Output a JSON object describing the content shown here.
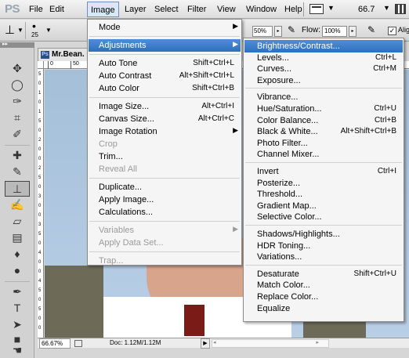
{
  "app": {
    "logo": "PS"
  },
  "menubar": {
    "items": [
      "File",
      "Edit",
      "Image",
      "Layer",
      "Select",
      "Filter",
      "View",
      "Window",
      "Help"
    ],
    "active": "Image",
    "zoom": "66.7"
  },
  "options_bar": {
    "brush_size": "25",
    "opacity": "50%",
    "flow_label": "Flow:",
    "flow": "100%",
    "aligned_label": "Aligned",
    "aligned_checked": true
  },
  "toolbox": {
    "tools": [
      "move",
      "lasso",
      "quick-selection",
      "crop",
      "eyedropper",
      "spot-healing",
      "brush",
      "clone-stamp",
      "history-brush",
      "eraser",
      "gradient",
      "blur",
      "dodge",
      "pen",
      "type",
      "path-selection",
      "rectangle",
      "hand",
      "zoom"
    ],
    "active": "clone-stamp"
  },
  "document": {
    "tab_title": "Mr.Bean.",
    "tab_icon": "Ps",
    "ruler_top": [
      "0",
      "50"
    ],
    "ruler_left": [
      "5",
      "0",
      "1",
      "0",
      "1",
      "5",
      "0",
      "2",
      "0",
      "0",
      "2",
      "5",
      "0",
      "3",
      "0",
      "0",
      "3",
      "5",
      "0",
      "4",
      "0",
      "0",
      "4",
      "5",
      "0",
      "5",
      "0",
      "0"
    ],
    "status_zoom": "66.67%",
    "status_doc": "Doc: 1.12M/1.12M"
  },
  "image_menu": {
    "items": [
      {
        "label": "Mode",
        "shortcut": "",
        "submenu": true,
        "disabled": false,
        "highlight": false
      },
      {
        "sep": true
      },
      {
        "label": "Adjustments",
        "shortcut": "",
        "submenu": true,
        "disabled": false,
        "highlight": true
      },
      {
        "sep": true
      },
      {
        "label": "Auto Tone",
        "shortcut": "Shift+Ctrl+L",
        "submenu": false,
        "disabled": false,
        "highlight": false
      },
      {
        "label": "Auto Contrast",
        "shortcut": "Alt+Shift+Ctrl+L",
        "submenu": false,
        "disabled": false,
        "highlight": false
      },
      {
        "label": "Auto Color",
        "shortcut": "Shift+Ctrl+B",
        "submenu": false,
        "disabled": false,
        "highlight": false
      },
      {
        "sep": true
      },
      {
        "label": "Image Size...",
        "shortcut": "Alt+Ctrl+I",
        "submenu": false,
        "disabled": false,
        "highlight": false
      },
      {
        "label": "Canvas Size...",
        "shortcut": "Alt+Ctrl+C",
        "submenu": false,
        "disabled": false,
        "highlight": false
      },
      {
        "label": "Image Rotation",
        "shortcut": "",
        "submenu": true,
        "disabled": false,
        "highlight": false
      },
      {
        "label": "Crop",
        "shortcut": "",
        "submenu": false,
        "disabled": true,
        "highlight": false
      },
      {
        "label": "Trim...",
        "shortcut": "",
        "submenu": false,
        "disabled": false,
        "highlight": false
      },
      {
        "label": "Reveal All",
        "shortcut": "",
        "submenu": false,
        "disabled": true,
        "highlight": false
      },
      {
        "sep": true
      },
      {
        "label": "Duplicate...",
        "shortcut": "",
        "submenu": false,
        "disabled": false,
        "highlight": false
      },
      {
        "label": "Apply Image...",
        "shortcut": "",
        "submenu": false,
        "disabled": false,
        "highlight": false
      },
      {
        "label": "Calculations...",
        "shortcut": "",
        "submenu": false,
        "disabled": false,
        "highlight": false
      },
      {
        "sep": true
      },
      {
        "label": "Variables",
        "shortcut": "",
        "submenu": true,
        "disabled": true,
        "highlight": false
      },
      {
        "label": "Apply Data Set...",
        "shortcut": "",
        "submenu": false,
        "disabled": true,
        "highlight": false
      },
      {
        "sep": true
      },
      {
        "label": "Trap...",
        "shortcut": "",
        "submenu": false,
        "disabled": true,
        "highlight": false
      }
    ]
  },
  "adjustments_menu": {
    "items": [
      {
        "label": "Brightness/Contrast...",
        "shortcut": "",
        "highlight": true
      },
      {
        "label": "Levels...",
        "shortcut": "Ctrl+L",
        "highlight": false
      },
      {
        "label": "Curves...",
        "shortcut": "Ctrl+M",
        "highlight": false
      },
      {
        "label": "Exposure...",
        "shortcut": "",
        "highlight": false
      },
      {
        "sep": true
      },
      {
        "label": "Vibrance...",
        "shortcut": "",
        "highlight": false
      },
      {
        "label": "Hue/Saturation...",
        "shortcut": "Ctrl+U",
        "highlight": false
      },
      {
        "label": "Color Balance...",
        "shortcut": "Ctrl+B",
        "highlight": false
      },
      {
        "label": "Black & White...",
        "shortcut": "Alt+Shift+Ctrl+B",
        "highlight": false
      },
      {
        "label": "Photo Filter...",
        "shortcut": "",
        "highlight": false
      },
      {
        "label": "Channel Mixer...",
        "shortcut": "",
        "highlight": false
      },
      {
        "sep": true
      },
      {
        "label": "Invert",
        "shortcut": "Ctrl+I",
        "highlight": false
      },
      {
        "label": "Posterize...",
        "shortcut": "",
        "highlight": false
      },
      {
        "label": "Threshold...",
        "shortcut": "",
        "highlight": false
      },
      {
        "label": "Gradient Map...",
        "shortcut": "",
        "highlight": false
      },
      {
        "label": "Selective Color...",
        "shortcut": "",
        "highlight": false
      },
      {
        "sep": true
      },
      {
        "label": "Shadows/Highlights...",
        "shortcut": "",
        "highlight": false
      },
      {
        "label": "HDR Toning...",
        "shortcut": "",
        "highlight": false
      },
      {
        "label": "Variations...",
        "shortcut": "",
        "highlight": false
      },
      {
        "sep": true
      },
      {
        "label": "Desaturate",
        "shortcut": "Shift+Ctrl+U",
        "highlight": false
      },
      {
        "label": "Match Color...",
        "shortcut": "",
        "highlight": false
      },
      {
        "label": "Replace Color...",
        "shortcut": "",
        "highlight": false
      },
      {
        "label": "Equalize",
        "shortcut": "",
        "highlight": false
      }
    ]
  }
}
